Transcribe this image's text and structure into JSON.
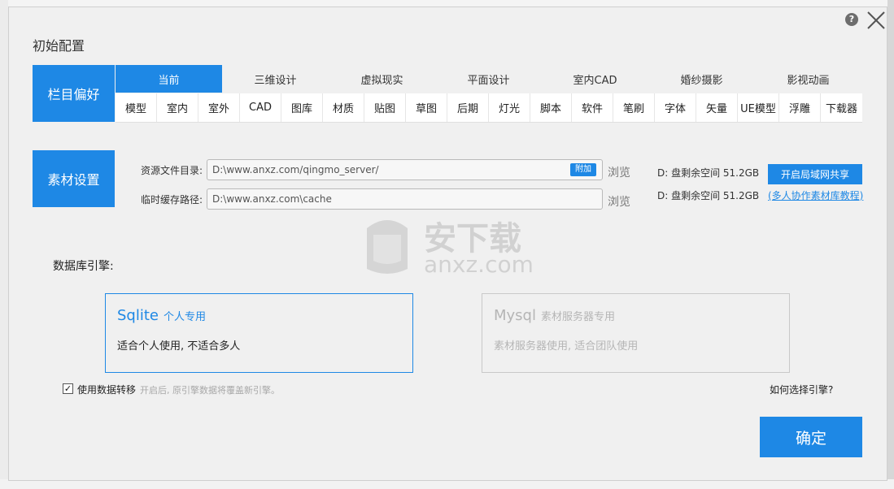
{
  "dialog": {
    "title": "初始配置",
    "help_glyph": "?"
  },
  "sections": {
    "columns_label": "栏目偏好",
    "material_label": "素材设置"
  },
  "tabs_main": [
    {
      "label": "当前",
      "active": true
    },
    {
      "label": "三维设计",
      "active": false
    },
    {
      "label": "虚拟现实",
      "active": false
    },
    {
      "label": "平面设计",
      "active": false
    },
    {
      "label": "室内CAD",
      "active": false
    },
    {
      "label": "婚纱摄影",
      "active": false
    },
    {
      "label": "影视动画",
      "active": false
    }
  ],
  "tabs_sub": [
    "模型",
    "室内",
    "室外",
    "CAD",
    "图库",
    "材质",
    "贴图",
    "草图",
    "后期",
    "灯光",
    "脚本",
    "软件",
    "笔刷",
    "字体",
    "矢量",
    "UE模型",
    "浮雕",
    "下载器"
  ],
  "material": {
    "resource_dir_label": "资源文件目录:",
    "resource_dir_value": "D:\\www.anxz.com/qingmo_server/",
    "attach_label": "附加",
    "cache_path_label": "临时缓存路径:",
    "cache_path_value": "D:\\www.anxz.com\\cache",
    "browse_label": "浏览",
    "disk_info": "D: 盘剩余空间 51.2GB",
    "share_button": "开启局域网共享",
    "tutorial_link": "(多人协作素材库教程)"
  },
  "database": {
    "label": "数据库引擎:",
    "sqlite_title": "Sqlite",
    "sqlite_sub": "个人专用",
    "sqlite_desc": "适合个人使用, 不适合多人",
    "mysql_title": "Mysql",
    "mysql_sub": "素材服务器专用",
    "mysql_desc": "素材服务器使用, 适合团队使用",
    "migrate_label": "使用数据转移",
    "migrate_checked": true,
    "migrate_hint": "开启后, 原引擎数据将覆盖新引擎。",
    "how_choose": "如何选择引擎?"
  },
  "footer": {
    "ok_button": "确定"
  },
  "watermark": {
    "cn": "安下载",
    "en": "anxz.com"
  },
  "colors": {
    "accent": "#1e88e5",
    "dialog_bg": "#f0f0f0"
  }
}
